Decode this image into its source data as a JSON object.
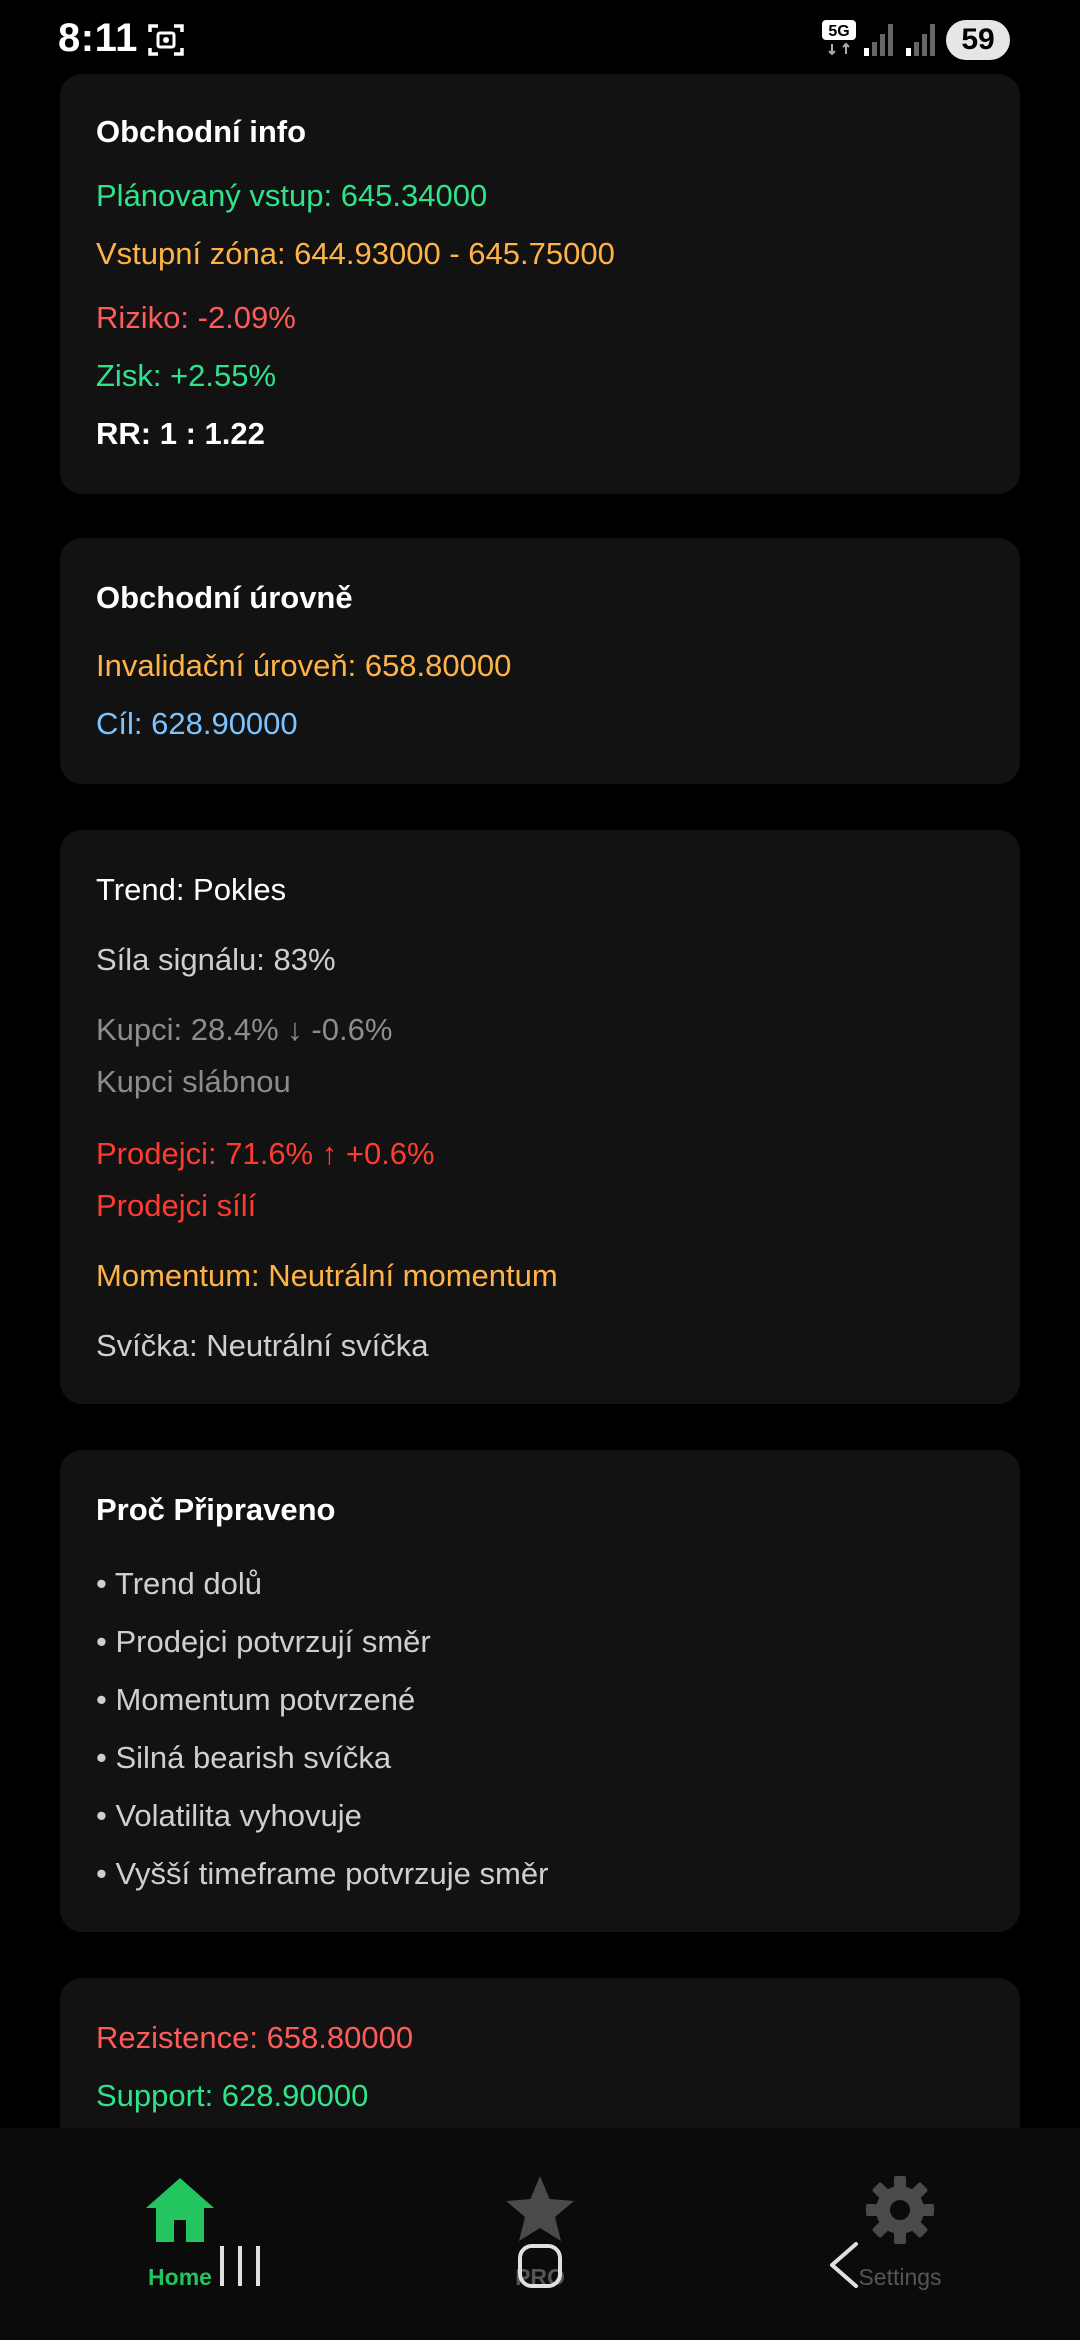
{
  "status_bar": {
    "time": "8:11",
    "network": "5G",
    "battery": "59"
  },
  "trade_info": {
    "title": "Obchodní info",
    "planned_entry": "Plánovaný vstup: 645.34000",
    "entry_zone": "Vstupní zóna: 644.93000 - 645.75000",
    "risk": "Riziko: -2.09%",
    "profit": "Zisk: +2.55%",
    "rr": "RR: 1 : 1.22"
  },
  "trade_levels": {
    "title": "Obchodní úrovně",
    "invalidation": "Invalidační úroveň: 658.80000",
    "target": "Cíl: 628.90000"
  },
  "analysis": {
    "trend": "Trend: Pokles",
    "signal_strength": "Síla signálu: 83%",
    "buyers": "Kupci: 28.4% ↓ -0.6%",
    "buyers_note": "Kupci slábnou",
    "sellers": "Prodejci: 71.6% ↑ +0.6%",
    "sellers_note": "Prodejci sílí",
    "momentum": "Momentum: Neutrální momentum",
    "candle": "Svíčka: Neutrální svíčka"
  },
  "reasons": {
    "title": "Proč Připraveno",
    "items": [
      "• Trend dolů",
      "• Prodejci potvrzují směr",
      "• Momentum potvrzené",
      "• Silná bearish svíčka",
      "• Volatilita vyhovuje",
      "• Vyšší timeframe potvrzuje směr"
    ]
  },
  "levels": {
    "resistance": "Rezistence: 658.80000",
    "support": "Support: 628.90000"
  },
  "bottom_nav": {
    "home": "Home",
    "pro": "PRO",
    "settings": "Settings"
  },
  "colors": {
    "home_active": "#22c55e",
    "inactive": "#555555",
    "card_bg": "#121212"
  },
  "icons": {
    "home": "home-icon",
    "pro": "star-icon",
    "settings": "gear-icon"
  }
}
